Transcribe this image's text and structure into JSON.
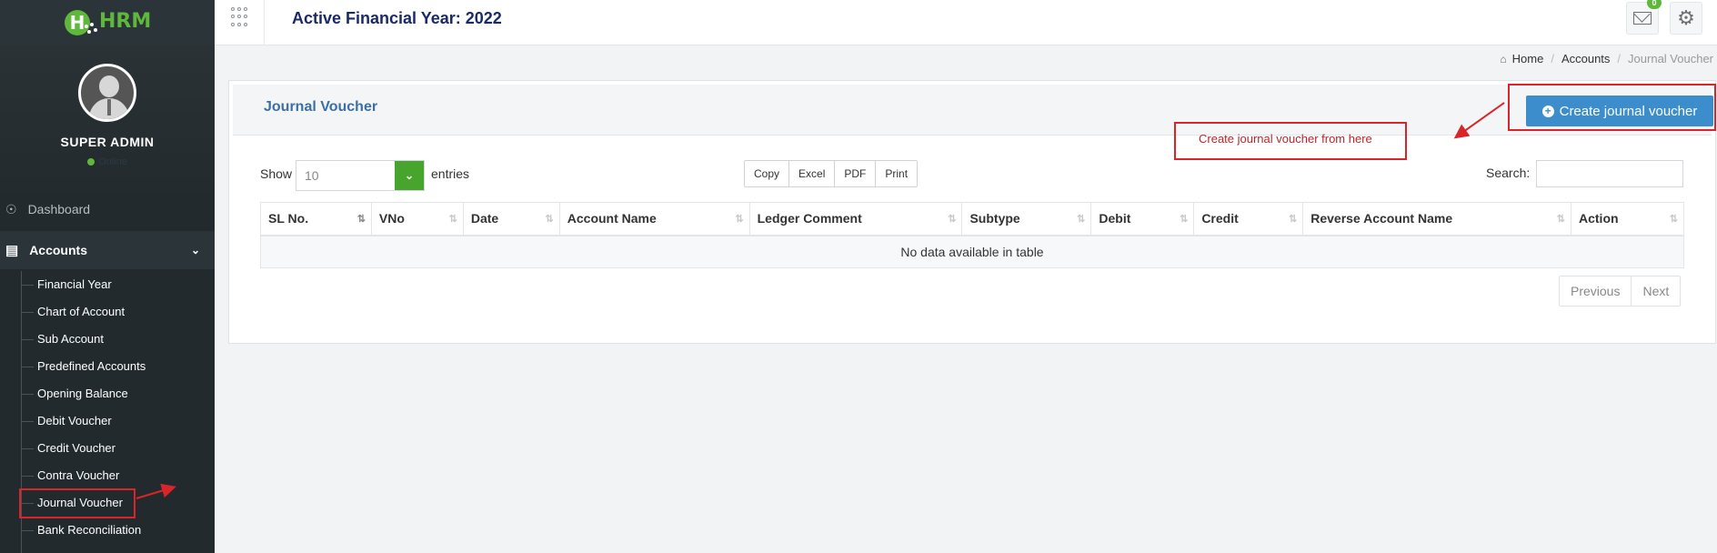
{
  "brand": {
    "logo_text": "HRM"
  },
  "profile": {
    "name": "SUPER ADMIN",
    "status": "Online"
  },
  "sidebar": {
    "dashboard_label": "Dashboard",
    "accounts_label": "Accounts",
    "items": [
      "Financial Year",
      "Chart of Account",
      "Sub Account",
      "Predefined Accounts",
      "Opening Balance",
      "Debit Voucher",
      "Credit Voucher",
      "Contra Voucher",
      "Journal Voucher",
      "Bank Reconciliation"
    ],
    "active_item": "Journal Voucher"
  },
  "topbar": {
    "financial_year": "Active Financial Year: 2022",
    "mail_badge": "0",
    "icons": [
      "apps-grid-icon",
      "mail-icon",
      "gear-icon"
    ]
  },
  "breadcrumb": {
    "home": "Home",
    "section": "Accounts",
    "current": "Journal Voucher"
  },
  "panel": {
    "title": "Journal Voucher",
    "create_button": "Create journal voucher"
  },
  "controls": {
    "show_label": "Show",
    "page_length": "10",
    "entries_label": "entries",
    "export_buttons": [
      "Copy",
      "Excel",
      "PDF",
      "Print"
    ],
    "search_label": "Search:",
    "search_value": ""
  },
  "table": {
    "columns": [
      "SL No.",
      "VNo",
      "Date",
      "Account Name",
      "Ledger Comment",
      "Subtype",
      "Debit",
      "Credit",
      "Reverse Account Name",
      "Action"
    ],
    "empty_message": "No data available in table"
  },
  "pagination": {
    "previous": "Previous",
    "next": "Next"
  },
  "annotation": {
    "note": "Create journal voucher from here"
  },
  "colors": {
    "sidebar_bg": "#222a2e",
    "brand_green": "#5fb83b",
    "primary_blue": "#3c8dcb",
    "title_navy": "#1a2a66",
    "annotation_red": "#d9252a"
  }
}
